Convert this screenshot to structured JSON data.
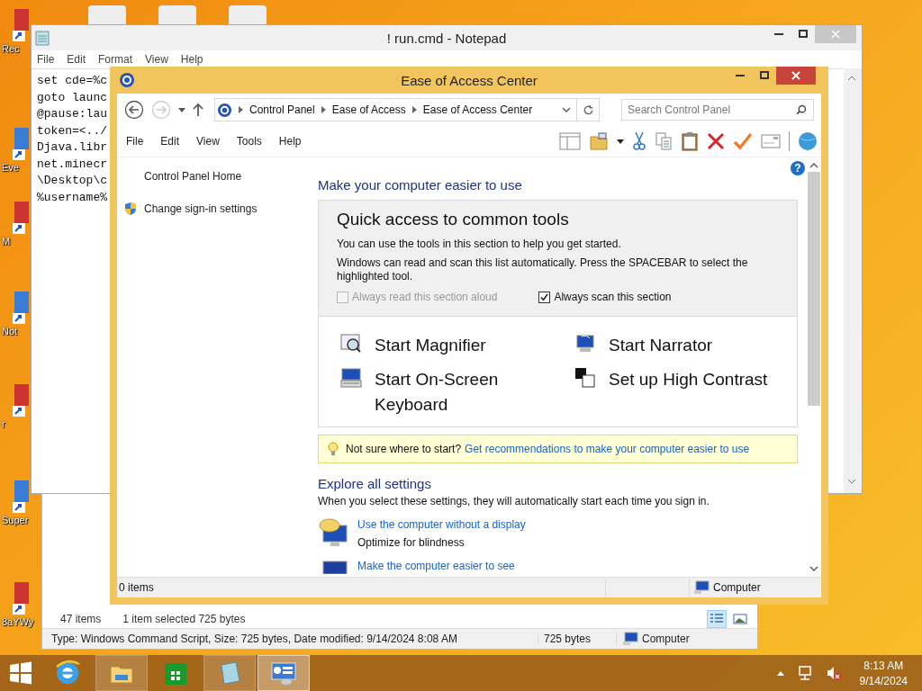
{
  "desktop": {
    "icons": [
      {
        "label": "Rec"
      },
      {
        "label": "Eve"
      },
      {
        "label": "M"
      },
      {
        "label": "Not"
      },
      {
        "label": "r"
      },
      {
        "label": "Super"
      },
      {
        "label": "8aYWy"
      }
    ]
  },
  "explorer": {
    "status": [
      "47 items",
      "1 item selected  725 bytes"
    ],
    "view_buttons": [
      {
        "kind": "details",
        "selected": true
      },
      {
        "kind": "preview",
        "selected": false
      }
    ],
    "details": "Type: Windows Command Script, Size: 725 bytes, Date modified: 9/14/2024 8:08 AM",
    "size": "725 bytes",
    "zone": "Computer"
  },
  "notepad": {
    "title": "! run.cmd - Notepad",
    "menu": [
      "File",
      "Edit",
      "Format",
      "View",
      "Help"
    ],
    "lines": [
      "set cde=%c",
      "goto launc",
      "@pause:lau",
      "token=<../",
      "Djava.libr",
      "net.minecr",
      "\\Desktop\\c",
      "%username%"
    ]
  },
  "ease_window": {
    "title": "Ease of Access Center",
    "breadcrumb": [
      "Control Panel",
      "Ease of Access",
      "Ease of Access Center"
    ],
    "search": {
      "placeholder": "Search Control Panel"
    },
    "menu": [
      "File",
      "Edit",
      "View",
      "Tools",
      "Help"
    ],
    "help": "?",
    "sidebar": [
      {
        "label": "Control Panel Home",
        "kind": "plain"
      },
      {
        "label": "Change sign-in settings",
        "kind": "shield"
      }
    ],
    "heading": "Make your computer easier to use",
    "quick_access": {
      "title": "Quick access to common tools",
      "intro": "You can use the tools in this section to help you get started.",
      "scan_note": "Windows can read and scan this list automatically.  Press the SPACEBAR to select the highlighted tool.",
      "checkboxes": [
        {
          "label": "Always read this section aloud",
          "checked": false,
          "disabled": true
        },
        {
          "label": "Always scan this section",
          "checked": true,
          "disabled": false
        }
      ],
      "tools": [
        {
          "label": "Start Magnifier",
          "kind": "magnifier"
        },
        {
          "label": "Start Narrator",
          "kind": "narrator"
        },
        {
          "label": "Start On-Screen Keyboard",
          "kind": "keyboard"
        },
        {
          "label": "Set up High Contrast",
          "kind": "contrast"
        }
      ]
    },
    "tip": {
      "text": "Not sure where to start?",
      "link": "Get recommendations to make your computer easier to use"
    },
    "explore": {
      "title": "Explore all settings",
      "intro": "When you select these settings, they will automatically start each time you sign in.",
      "items": [
        {
          "link": "Use the computer without a display",
          "description": "Optimize for blindness",
          "kind": "display"
        },
        {
          "link": "Make the computer easier to see",
          "kind": "see"
        }
      ]
    },
    "status": {
      "items": "0 items",
      "zone": "Computer"
    }
  },
  "taskbar": {
    "apps": [
      {
        "kind": "ie",
        "running": false,
        "selected": false
      },
      {
        "kind": "explorer",
        "running": true,
        "selected": false
      },
      {
        "kind": "store",
        "running": false,
        "selected": false
      },
      {
        "kind": "notepad",
        "running": true,
        "selected": false
      },
      {
        "kind": "control",
        "running": true,
        "selected": true
      }
    ],
    "time": "8:13 AM",
    "date": "9/14/2024"
  }
}
